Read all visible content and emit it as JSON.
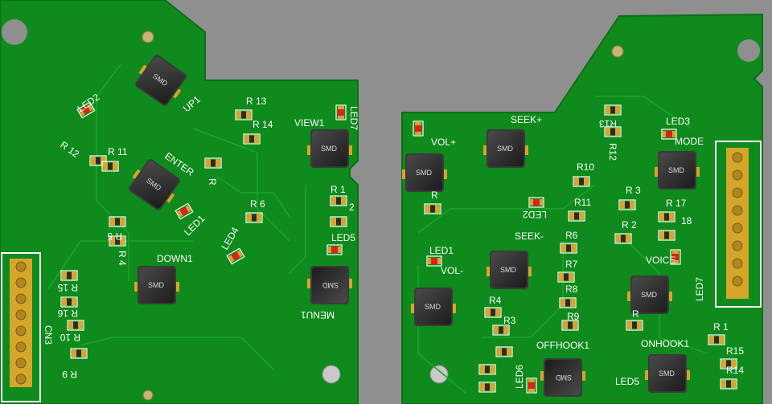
{
  "window_title": "",
  "colors": {
    "background": "#8f8f8f",
    "board": "#0f8a1c",
    "board_edge": "#0b6f16",
    "trace": "#1aa52b",
    "pad": "#d6a62c",
    "smd_body": "#2a2a2a",
    "led": "#e0201c",
    "silkscreen": "#ffffff"
  },
  "switch_body_text": "SMD",
  "left_board": {
    "labels": {
      "led2": "LED2",
      "up1": "UP1",
      "r13": "R 13",
      "r14": "R 14",
      "view1": "VIEW1",
      "led7_top": "LED7",
      "r12": "R 12",
      "r11": "R 11",
      "enter": "ENTER",
      "r_enter": "R",
      "r1": "R 1",
      "r2": "2",
      "r6": "R 6",
      "led1": "LED1",
      "led4": "LED4",
      "led5": "LED5",
      "r5": "R 5",
      "r4": "R 4",
      "down1": "DOWN1",
      "menu1": "MENU1",
      "r15": "R 15",
      "r16": "R 16",
      "r10": "R 10",
      "r9": "R 9",
      "cn3": "CN3"
    }
  },
  "right_board": {
    "labels": {
      "seek_plus": "SEEK+",
      "vol_plus": "VOL+",
      "led3": "LED3",
      "mode": "MODE",
      "r13": "R13",
      "r12": "R12",
      "r10": "R10",
      "r11": "R11",
      "r3_top": "R 3",
      "r17": "R 17",
      "r18": "18",
      "r2": "R 2",
      "led2": "LED2",
      "led1": "LED1",
      "seek_minus": "SEEK-",
      "r6": "R6",
      "r7": "R7",
      "r8": "R8",
      "r9": "R9",
      "r4": "R4",
      "r3": "R3",
      "vol_minus": "VOL-",
      "voice": "VOICE",
      "led7": "LED7",
      "offhook": "OFFHOOK1",
      "onhook": "ONHOOK1",
      "r1": "R 1",
      "r15": "R15",
      "r14": "R14",
      "led6": "LED6",
      "led5": "LED5",
      "r_bottom": "R",
      "r_c": "R"
    }
  }
}
